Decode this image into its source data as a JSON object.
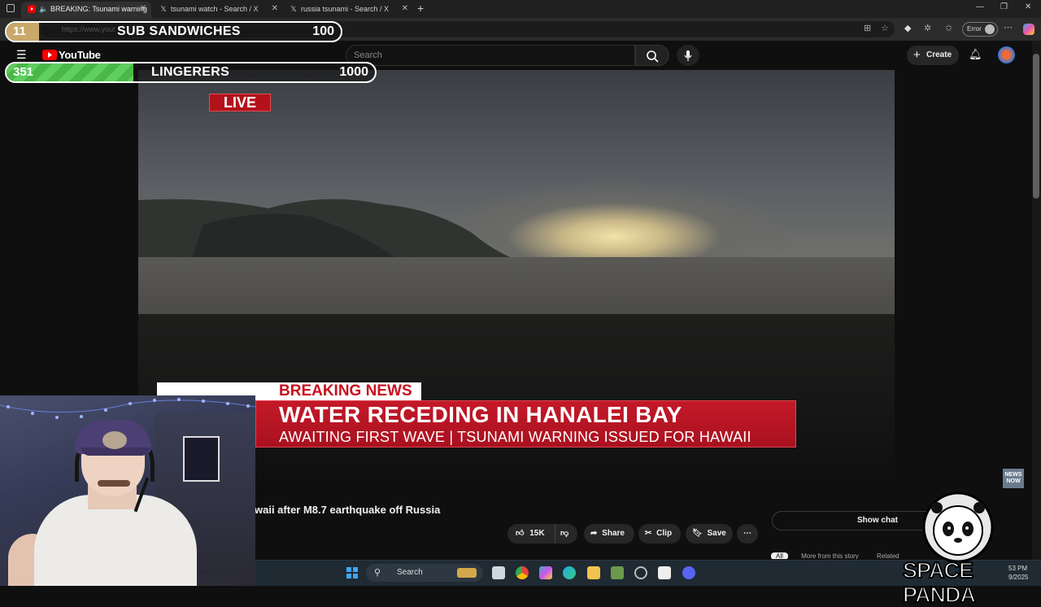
{
  "browser": {
    "tabs": [
      {
        "title": "BREAKING: Tsunami warning",
        "favicon": "youtube-icon"
      },
      {
        "title": "tsunami watch - Search / X",
        "favicon": "x-icon"
      },
      {
        "title": "russia tsunami - Search / X",
        "favicon": "x-icon"
      }
    ],
    "url": "https://www.yout",
    "profile_status": "Error"
  },
  "youtube": {
    "logo": "YouTube",
    "search_placeholder": "Search",
    "create_label": "Create"
  },
  "video": {
    "live_badge": "LIVE",
    "breaking_label": "BREAKING NEWS",
    "headline": "WATER RECEDING IN HANALEI BAY",
    "subline": "AWAITING FIRST WAVE | TSUNAMI WARNING ISSUED FOR HAWAII",
    "network_bug": "NEWS NOW",
    "title": "waii after M8.7 earthquake off Russia",
    "like_count": "15K",
    "share_label": "Share",
    "clip_label": "Clip",
    "save_label": "Save",
    "show_chat_label": "Show chat",
    "chips": [
      "All",
      "More from this story",
      "Related"
    ]
  },
  "overlay": {
    "goals": [
      {
        "label": "SUB SANDWICHES",
        "current": "11",
        "target": "100",
        "progress": 0.11
      },
      {
        "label": "LINGERERS",
        "current": "351",
        "target": "1000",
        "progress": 0.351
      }
    ],
    "brand": "SPACE PANDA"
  },
  "taskbar": {
    "search_placeholder": "Search",
    "time": "53 PM",
    "date": "9/2025"
  },
  "colors": {
    "youtube_red": "#ff0000",
    "breaking_red": "#c41929",
    "lingerers_fill": "#5fcf5f",
    "subs_fill": "#c9a86a"
  }
}
